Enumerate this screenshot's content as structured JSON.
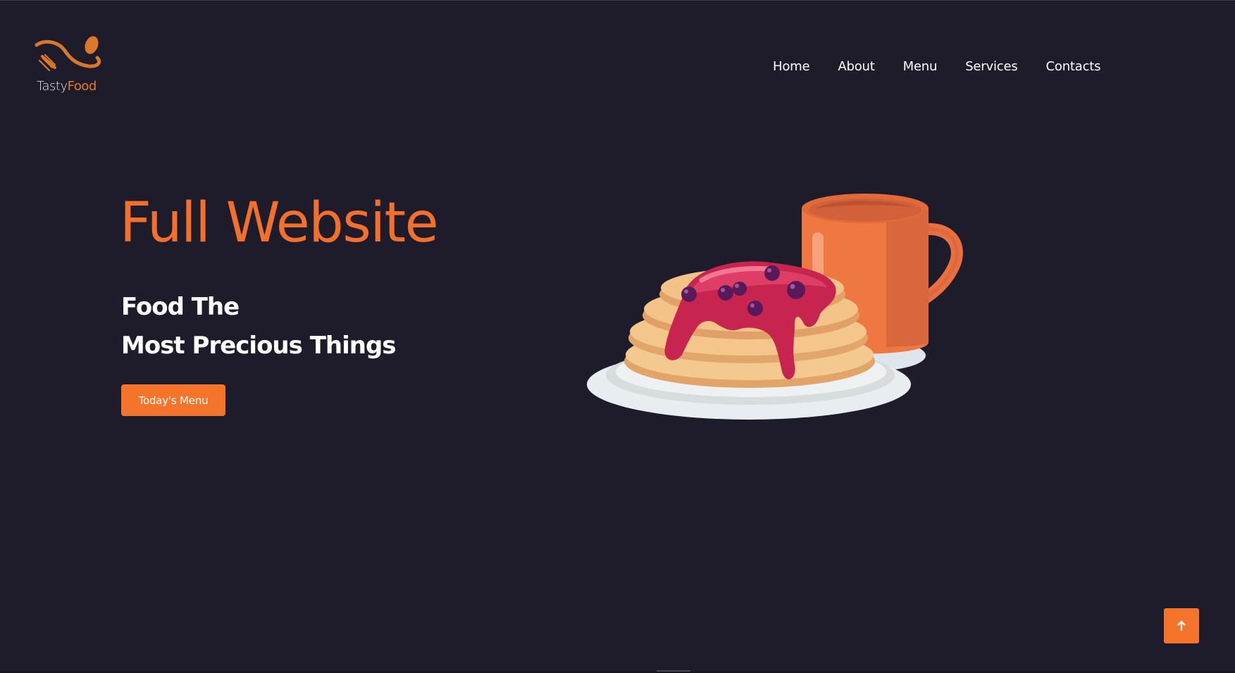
{
  "brand": {
    "name_part1": "Tasty",
    "name_part2": "Food",
    "accent_color": "#e07c2c",
    "icon": "fork-spoon-swirl-logo"
  },
  "nav": {
    "items": [
      {
        "label": "Home"
      },
      {
        "label": "About"
      },
      {
        "label": "Menu"
      },
      {
        "label": "Services"
      },
      {
        "label": "Contacts"
      }
    ]
  },
  "hero": {
    "title": "Full Website",
    "subtitle_line1": "Food The",
    "subtitle_line2": "Most Precious Things",
    "cta_label": "Today's Menu",
    "illustration": "pancakes-with-berry-syrup-and-mug"
  },
  "scroll_top": {
    "icon": "arrow-up-icon"
  },
  "colors": {
    "background": "#1e1c2a",
    "accent": "#f4742c",
    "text": "#ffffff"
  }
}
